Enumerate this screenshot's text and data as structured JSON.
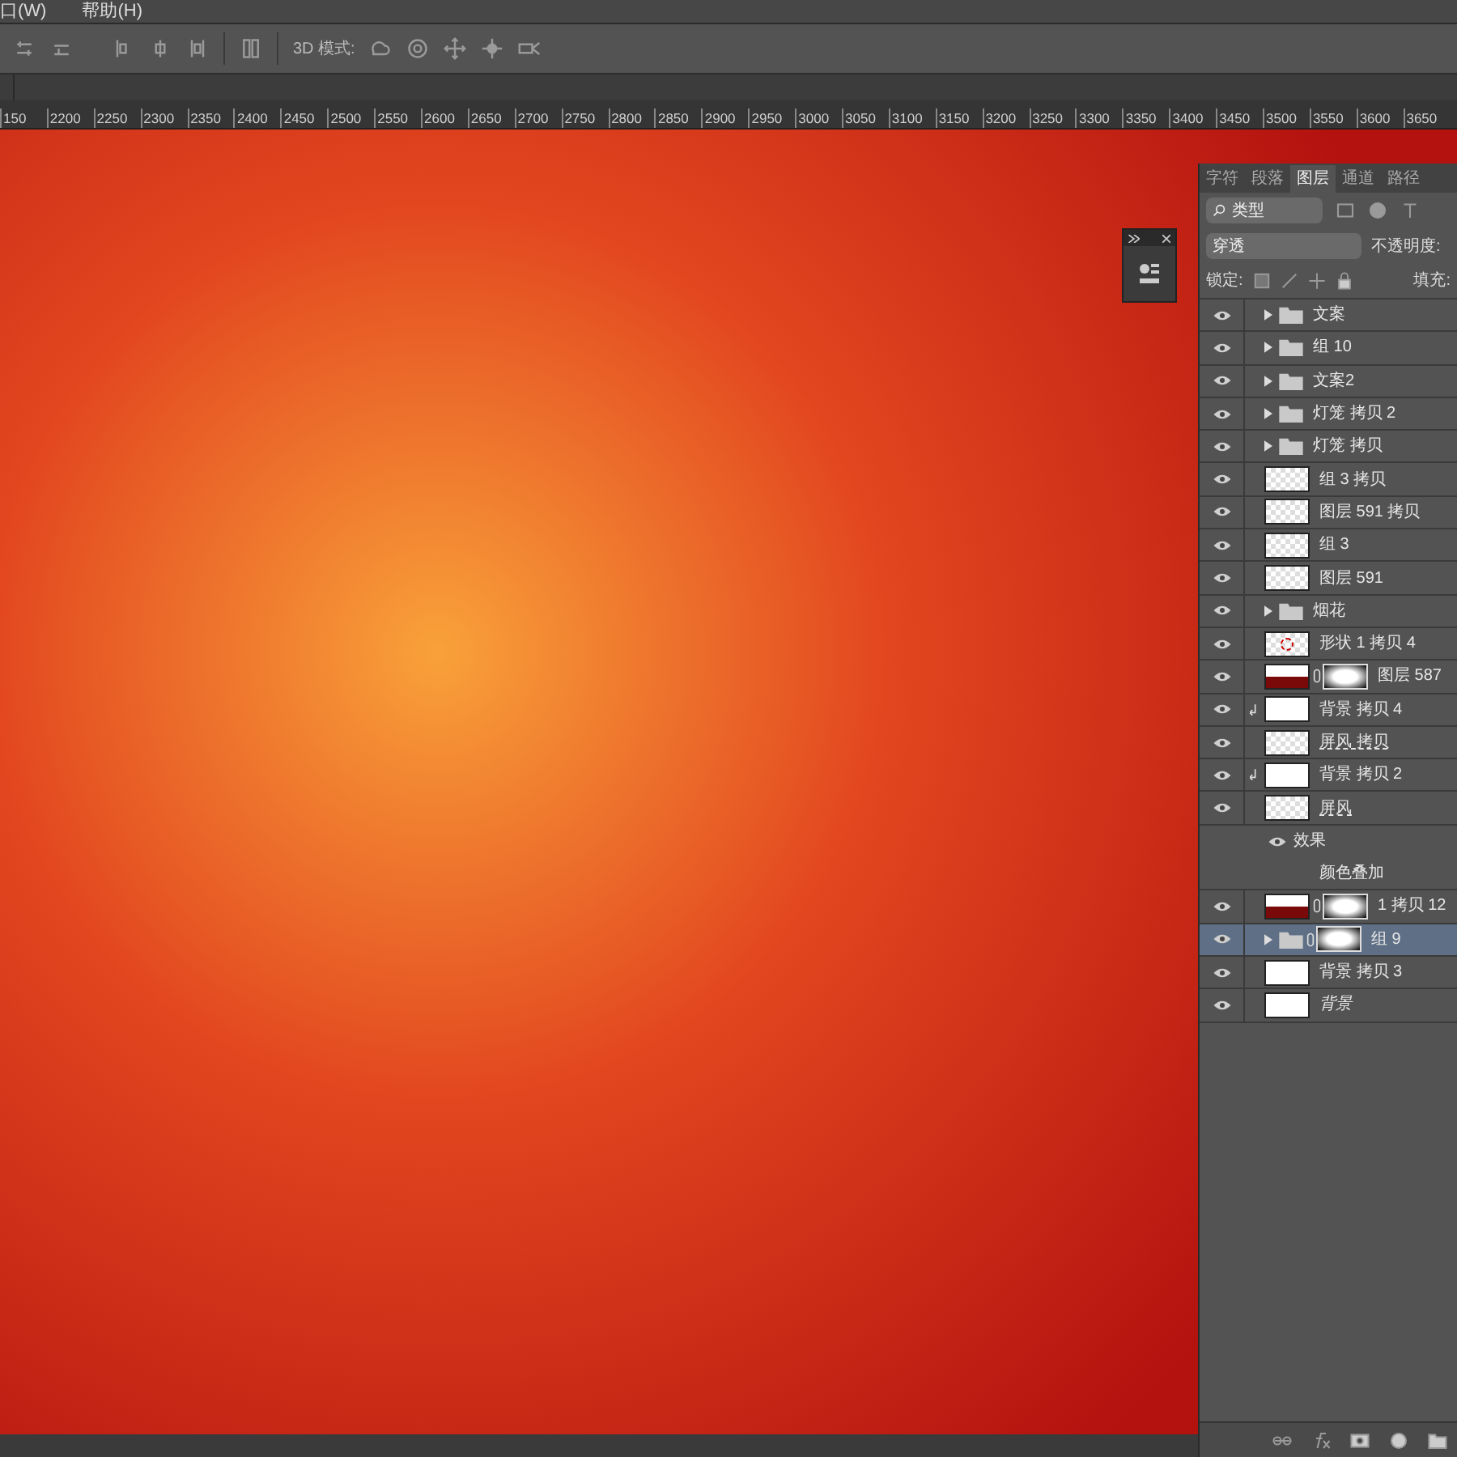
{
  "menu_bar": {
    "items": [
      "口(W)",
      "帮助(H)"
    ]
  },
  "options_bar": {
    "mode_label": "3D 模式:"
  },
  "ruler": {
    "ticks": [
      "150",
      "2200",
      "2250",
      "2300",
      "2350",
      "2400",
      "2450",
      "2500",
      "2550",
      "2600",
      "2650",
      "2700",
      "2750",
      "2800",
      "2850",
      "2900",
      "2950",
      "3000",
      "3050",
      "3100",
      "3150",
      "3200",
      "3250",
      "3300",
      "3350",
      "3400",
      "3450",
      "3500",
      "3550",
      "3600",
      "3650"
    ]
  },
  "layers_panel": {
    "tabs": [
      {
        "label": "字符",
        "selected": false
      },
      {
        "label": "段落",
        "selected": false
      },
      {
        "label": "图层",
        "selected": true
      },
      {
        "label": "通道",
        "selected": false
      },
      {
        "label": "路径",
        "selected": false
      }
    ],
    "filter": "类型",
    "blend_mode": "穿透",
    "opacity_label": "不透明度:",
    "lock_label": "锁定:",
    "fill_label": "填充:",
    "layers": [
      {
        "kind": "group",
        "name": "文案",
        "visible": true,
        "selected": false,
        "mask": false,
        "clipped": false,
        "underlined": false,
        "italic": false
      },
      {
        "kind": "group",
        "name": "组 10",
        "visible": true,
        "selected": false,
        "mask": false,
        "clipped": false,
        "underlined": false,
        "italic": false
      },
      {
        "kind": "group",
        "name": "文案2",
        "visible": true,
        "selected": false,
        "mask": false,
        "clipped": false,
        "underlined": false,
        "italic": false
      },
      {
        "kind": "group",
        "name": "灯笼 拷贝 2",
        "visible": true,
        "selected": false,
        "mask": false,
        "clipped": false,
        "underlined": false,
        "italic": false
      },
      {
        "kind": "group",
        "name": "灯笼 拷贝",
        "visible": true,
        "selected": false,
        "mask": false,
        "clipped": false,
        "underlined": false,
        "italic": false
      },
      {
        "kind": "transparent",
        "name": "组 3 拷贝",
        "visible": true,
        "selected": false,
        "mask": false,
        "clipped": false,
        "underlined": false,
        "italic": false
      },
      {
        "kind": "transparent",
        "name": "图层 591 拷贝",
        "visible": true,
        "selected": false,
        "mask": false,
        "clipped": false,
        "underlined": false,
        "italic": false
      },
      {
        "kind": "transparent",
        "name": "组 3",
        "visible": true,
        "selected": false,
        "mask": false,
        "clipped": false,
        "underlined": false,
        "italic": false
      },
      {
        "kind": "transparent",
        "name": "图层 591",
        "visible": true,
        "selected": false,
        "mask": false,
        "clipped": false,
        "underlined": false,
        "italic": false
      },
      {
        "kind": "group",
        "name": "烟花",
        "visible": true,
        "selected": false,
        "mask": false,
        "clipped": false,
        "underlined": false,
        "italic": false
      },
      {
        "kind": "shape",
        "name": "形状 1 拷贝 4",
        "visible": true,
        "selected": false,
        "mask": false,
        "clipped": false,
        "underlined": false,
        "italic": false
      },
      {
        "kind": "image",
        "name": "图层 587",
        "visible": true,
        "selected": false,
        "mask": true,
        "clipped": false,
        "underlined": false,
        "italic": false
      },
      {
        "kind": "white",
        "name": "背景 拷贝 4",
        "visible": true,
        "selected": false,
        "mask": false,
        "clipped": true,
        "underlined": false,
        "italic": false
      },
      {
        "kind": "transparent",
        "name": "屏风 拷贝",
        "visible": true,
        "selected": false,
        "mask": false,
        "clipped": false,
        "underlined": true,
        "italic": false
      },
      {
        "kind": "white",
        "name": "背景 拷贝 2",
        "visible": true,
        "selected": false,
        "mask": false,
        "clipped": true,
        "underlined": false,
        "italic": false
      },
      {
        "kind": "transparent",
        "name": "屏风",
        "visible": true,
        "selected": false,
        "mask": false,
        "clipped": false,
        "underlined": true,
        "italic": false,
        "effects_label": "效果",
        "effects": [
          "颜色叠加"
        ]
      },
      {
        "kind": "image",
        "name": "1 拷贝 12",
        "visible": true,
        "selected": false,
        "mask": true,
        "clipped": false,
        "underlined": false,
        "italic": false
      },
      {
        "kind": "group",
        "name": "组 9",
        "visible": true,
        "selected": true,
        "mask": true,
        "clipped": false,
        "underlined": false,
        "italic": false
      },
      {
        "kind": "white",
        "name": "背景 拷贝 3",
        "visible": true,
        "selected": false,
        "mask": false,
        "clipped": false,
        "underlined": false,
        "italic": false
      },
      {
        "kind": "white",
        "name": "背景",
        "visible": true,
        "selected": false,
        "mask": false,
        "clipped": false,
        "underlined": false,
        "italic": true
      }
    ]
  }
}
